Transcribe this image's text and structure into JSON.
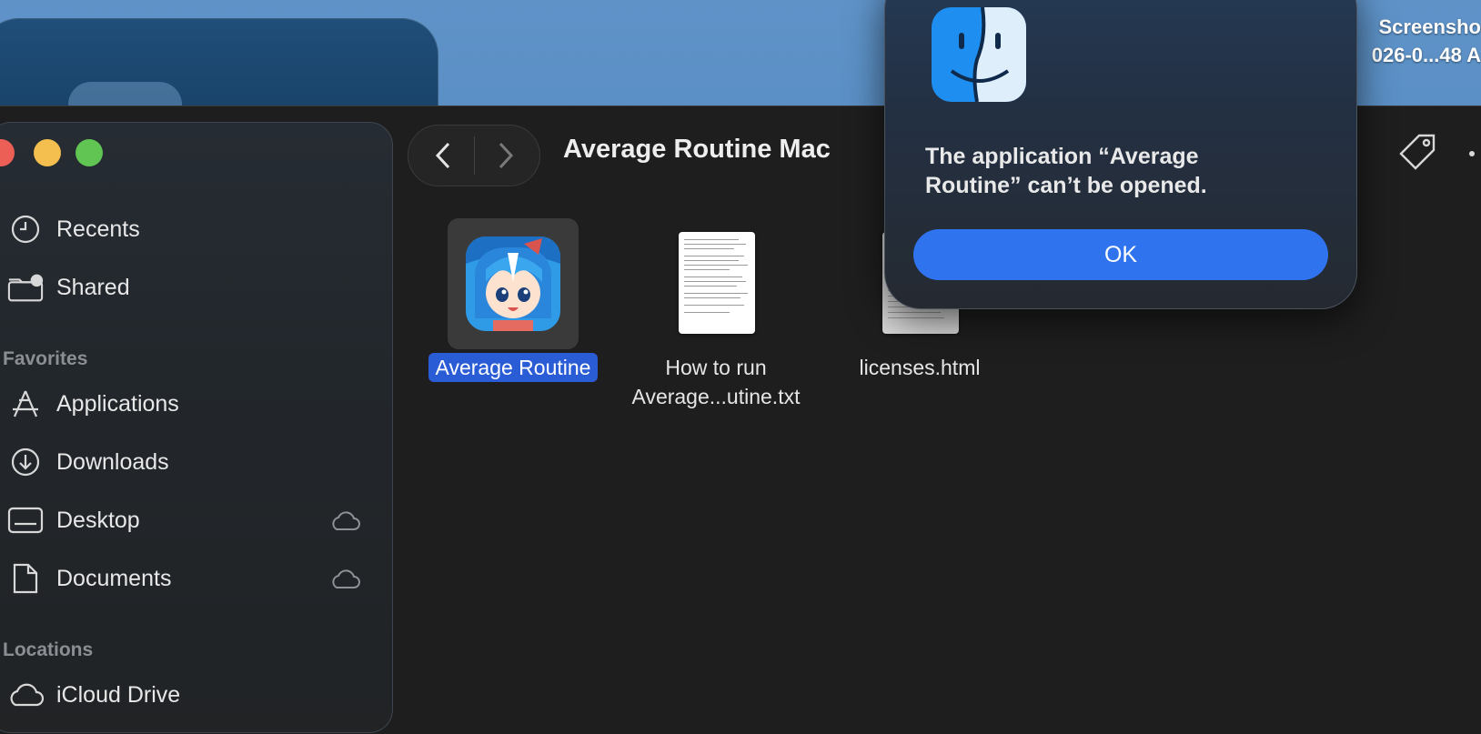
{
  "desktop": {
    "file_label_line1": "Screensho",
    "file_label_line2": "026-0...48 A"
  },
  "finder": {
    "title": "Average Routine Mac",
    "sidebar": {
      "top_items": [
        {
          "label": "Recents",
          "icon": "clock-icon"
        },
        {
          "label": "Shared",
          "icon": "shared-folder-icon"
        }
      ],
      "favorites_heading": "Favorites",
      "favorites": [
        {
          "label": "Applications",
          "icon": "applications-icon"
        },
        {
          "label": "Downloads",
          "icon": "download-icon"
        },
        {
          "label": "Desktop",
          "icon": "desktop-icon",
          "cloud": true
        },
        {
          "label": "Documents",
          "icon": "document-icon",
          "cloud": true
        }
      ],
      "locations_heading": "Locations",
      "locations": [
        {
          "label": "iCloud Drive",
          "icon": "cloud-icon"
        }
      ]
    },
    "files": [
      {
        "name": "Average Routine",
        "kind": "app",
        "selected": true
      },
      {
        "name_line1": "How to run",
        "name_line2": "Average...utine.txt",
        "kind": "text"
      },
      {
        "name": "licenses.html",
        "kind": "html"
      }
    ]
  },
  "dialog": {
    "message_line1": "The application “Average",
    "message_line2": "Routine” can’t be opened.",
    "ok_label": "OK"
  },
  "colors": {
    "selection": "#2a5cd6",
    "ok_button": "#2f73ee",
    "close": "#ec5f57",
    "minimize": "#f4bf4f",
    "zoom": "#61c554"
  }
}
